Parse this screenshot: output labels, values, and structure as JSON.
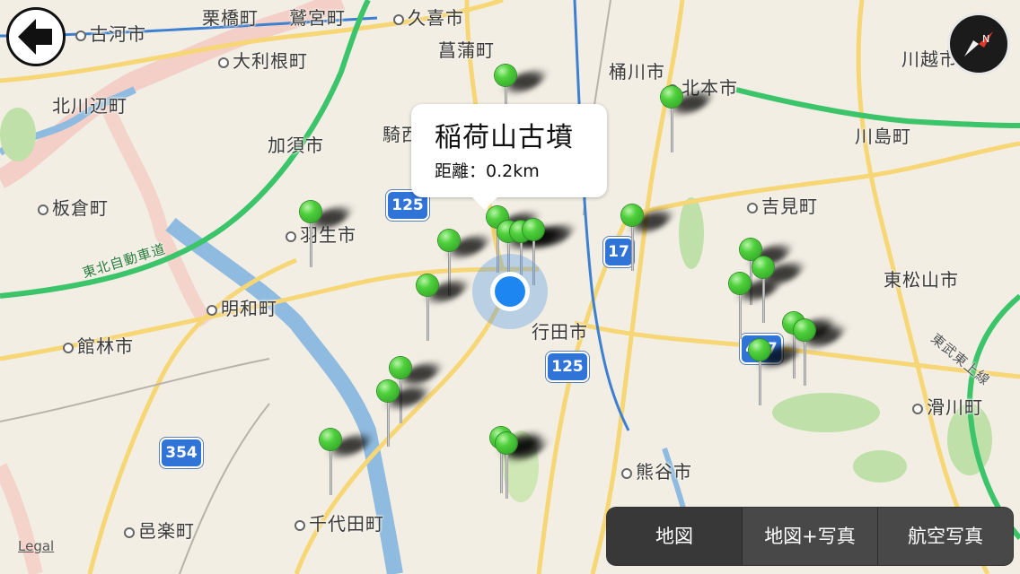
{
  "places": [
    {
      "id": "koga",
      "label": "古河市",
      "dot": true
    },
    {
      "id": "kurihashi",
      "label": "栗橋町",
      "dot": false
    },
    {
      "id": "washimiya",
      "label": "鷲宮町",
      "dot": false
    },
    {
      "id": "kuki",
      "label": "久喜市",
      "dot": true
    },
    {
      "id": "shobu",
      "label": "菖蒲町",
      "dot": false
    },
    {
      "id": "ootone",
      "label": "大利根町",
      "dot": true
    },
    {
      "id": "kitakawabe",
      "label": "北川辺町",
      "dot": false
    },
    {
      "id": "kazo",
      "label": "加須市",
      "dot": false
    },
    {
      "id": "kisai",
      "label": "騎西",
      "dot": false
    },
    {
      "id": "okegawa",
      "label": "桶川市",
      "dot": false
    },
    {
      "id": "kitamoto",
      "label": "北本市",
      "dot": true
    },
    {
      "id": "kawagoe",
      "label": "川越市",
      "dot": false
    },
    {
      "id": "kawajima",
      "label": "川島町",
      "dot": false
    },
    {
      "id": "itakura",
      "label": "板倉町",
      "dot": true
    },
    {
      "id": "hanyu",
      "label": "羽生市",
      "dot": true
    },
    {
      "id": "yoshimi",
      "label": "吉見町",
      "dot": true
    },
    {
      "id": "higashimatsuyama",
      "label": "東松山市",
      "dot": false
    },
    {
      "id": "meiwa",
      "label": "明和町",
      "dot": true
    },
    {
      "id": "tatebayashi",
      "label": "館林市",
      "dot": true
    },
    {
      "id": "gyoda",
      "label": "行田市",
      "dot": false
    },
    {
      "id": "namegawa",
      "label": "滑川町",
      "dot": true
    },
    {
      "id": "kumagaya",
      "label": "熊谷市",
      "dot": true
    },
    {
      "id": "ora",
      "label": "邑楽町",
      "dot": true
    },
    {
      "id": "chiyoda",
      "label": "千代田町",
      "dot": true
    }
  ],
  "expressway": {
    "tohoku": "東北自動車道",
    "tobu_tojo": "東武東上線"
  },
  "route_shields": [
    "125",
    "125",
    "17",
    "354",
    "407"
  ],
  "callout": {
    "title": "稲荷山古墳",
    "distance": "距離：0.2km"
  },
  "segmented_control": {
    "items": [
      "地図",
      "地図+写真",
      "航空写真"
    ],
    "selected_index": 0
  },
  "legal_label": "Legal",
  "colors": {
    "pin": "#4fd03c",
    "user_location": "#1e86f0",
    "shield": "#2f74d6",
    "highway": "#3cc46a",
    "prefecture_border": "#f2b8b0"
  },
  "icons": {
    "back": "back-arrow-icon",
    "compass": "compass-icon"
  }
}
